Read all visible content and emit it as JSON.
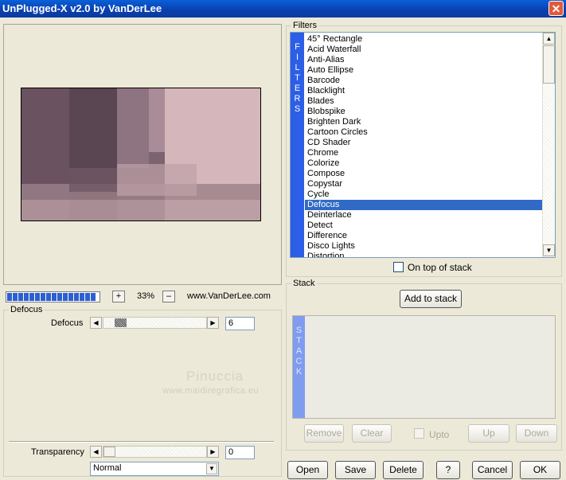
{
  "window": {
    "title": "UnPlugged-X v2.0 by VanDerLee",
    "close_icon": "✕"
  },
  "preview": {
    "zoom": "33%",
    "zoom_in": "+",
    "zoom_out": "–",
    "credit": "www.VanDerLee.com",
    "progress_fraction": 1.0
  },
  "params": {
    "group_label": "Defocus",
    "defocus_label": "Defocus",
    "defocus_value": "6",
    "watermark_name": "Pinuccia",
    "watermark_url": "www.maidiregrafica.eu",
    "transparency_label": "Transparency",
    "transparency_value": "0",
    "blend_mode": "Normal"
  },
  "filters": {
    "group_label": "Filters",
    "bar_letters": "F I L T E R S",
    "items": [
      "45° Rectangle",
      "Acid Waterfall",
      "Anti-Alias",
      "Auto Ellipse",
      "Barcode",
      "Blacklight",
      "Blades",
      "Blobspike",
      "Brighten Dark",
      "Cartoon Circles",
      "CD Shader",
      "Chrome",
      "Colorize",
      "Compose",
      "Copystar",
      "Cycle",
      "Defocus",
      "Deinterlace",
      "Detect",
      "Difference",
      "Disco Lights",
      "Distortion"
    ],
    "selected": "Defocus",
    "on_top_label": "On top of stack"
  },
  "stack": {
    "group_label": "Stack",
    "add_button": "Add to stack",
    "bar_letters": "S T A C K",
    "remove_button": "Remove",
    "clear_button": "Clear",
    "upto_label": "Upto",
    "up_button": "Up",
    "down_button": "Down"
  },
  "footer": {
    "open": "Open",
    "save": "Save",
    "delete": "Delete",
    "help": "?",
    "cancel": "Cancel",
    "ok": "OK"
  },
  "colors": {
    "accent": "#2c5ee6",
    "selection": "#316ac5",
    "titlebar": "#0a3fae"
  }
}
